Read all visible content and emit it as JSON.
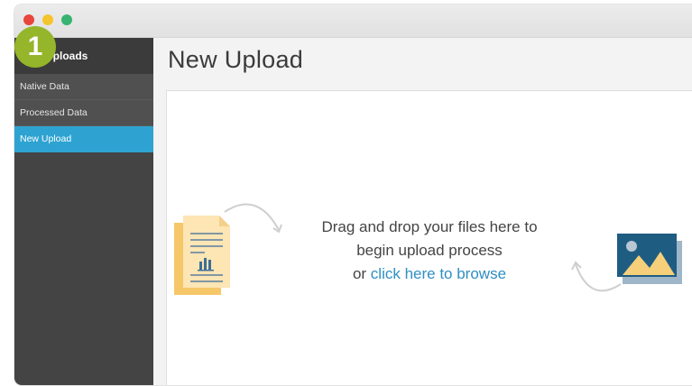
{
  "badge": "1",
  "sidebar": {
    "header": "Uploads",
    "items": [
      {
        "label": "Native Data"
      },
      {
        "label": "Processed Data"
      },
      {
        "label": "New Upload"
      }
    ]
  },
  "main": {
    "title": "New Upload",
    "dropzone": {
      "line1": "Drag and drop your files here to",
      "line2": "begin upload process",
      "or_text": "or ",
      "browse_link": "click here to browse"
    }
  },
  "colors": {
    "accent": "#2ea3d1",
    "badge": "#95b52b",
    "link": "#2e8fc2",
    "sidebar": "#444444"
  },
  "icons": [
    "document-chart-icon",
    "image-icon",
    "curved-arrow-icon"
  ]
}
